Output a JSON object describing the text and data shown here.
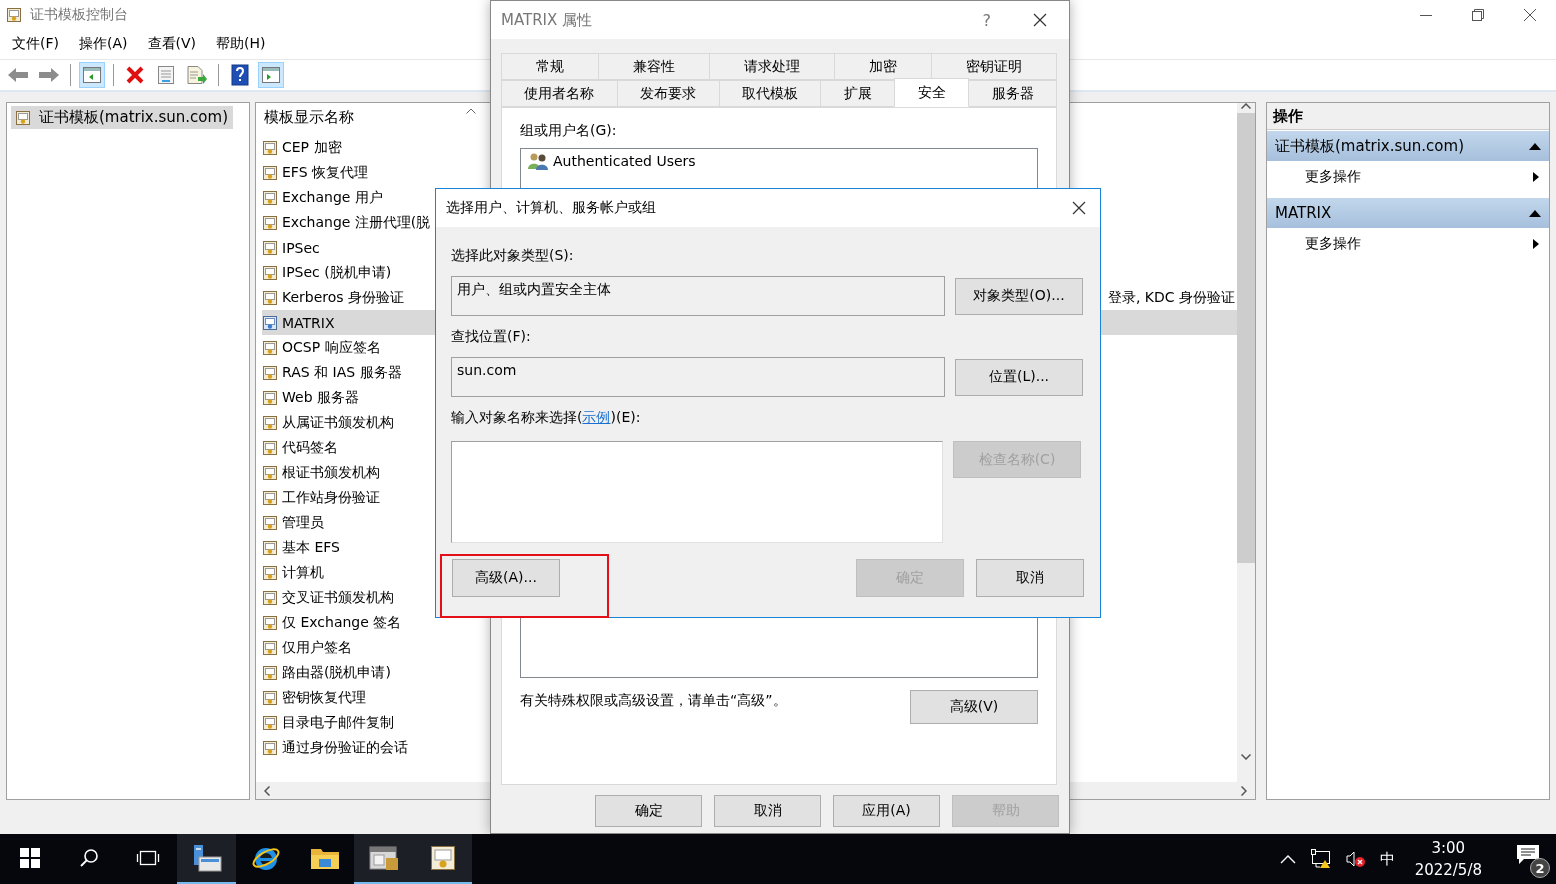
{
  "window": {
    "title": "证书模板控制台"
  },
  "menu": [
    "文件(F)",
    "操作(A)",
    "查看(V)",
    "帮助(H)"
  ],
  "toolbar": [
    {
      "kind": "back",
      "pressed": false
    },
    {
      "kind": "forward",
      "pressed": false
    },
    {
      "kind": "separator"
    },
    {
      "kind": "tree-pane",
      "pressed": true
    },
    {
      "kind": "separator"
    },
    {
      "kind": "delete",
      "pressed": false
    },
    {
      "kind": "properties",
      "pressed": false
    },
    {
      "kind": "export",
      "pressed": false
    },
    {
      "kind": "separator"
    },
    {
      "kind": "help",
      "pressed": false
    },
    {
      "kind": "action-pane",
      "pressed": true
    }
  ],
  "tree": {
    "items": [
      {
        "label": "证书模板(matrix.sun.com)",
        "selected": true
      }
    ]
  },
  "list": {
    "columns": [
      "模板显示名称"
    ],
    "rows": [
      {
        "name": "CEP 加密",
        "selected": false
      },
      {
        "name": "EFS 恢复代理",
        "selected": false
      },
      {
        "name": "Exchange 用户",
        "selected": false
      },
      {
        "name": "Exchange 注册代理(脱",
        "selected": false
      },
      {
        "name": "IPSec",
        "selected": false
      },
      {
        "name": "IPSec (脱机申请)",
        "selected": false
      },
      {
        "name": "Kerberos 身份验证",
        "column_2": "登录, KDC 身份验证",
        "selected": false
      },
      {
        "name": "MATRIX",
        "selected": true
      },
      {
        "name": "OCSP 响应签名",
        "selected": false
      },
      {
        "name": "RAS 和 IAS 服务器",
        "selected": false
      },
      {
        "name": "Web 服务器",
        "selected": false
      },
      {
        "name": "从属证书颁发机构",
        "selected": false
      },
      {
        "name": "代码签名",
        "selected": false
      },
      {
        "name": "根证书颁发机构",
        "selected": false
      },
      {
        "name": "工作站身份验证",
        "selected": false
      },
      {
        "name": "管理员",
        "selected": false
      },
      {
        "name": "基本 EFS",
        "selected": false
      },
      {
        "name": "计算机",
        "selected": false
      },
      {
        "name": "交叉证书颁发机构",
        "selected": false
      },
      {
        "name": "仅 Exchange 签名",
        "selected": false
      },
      {
        "name": "仅用户签名",
        "selected": false
      },
      {
        "name": "路由器(脱机申请)",
        "selected": false
      },
      {
        "name": "密钥恢复代理",
        "selected": false
      },
      {
        "name": "目录电子邮件复制",
        "selected": false
      },
      {
        "name": "通过身份验证的会话",
        "selected": false
      }
    ]
  },
  "actions": {
    "title": "操作",
    "sections": [
      {
        "title": "证书模板(matrix.sun.com)",
        "expanded": true,
        "items": [
          "更多操作"
        ]
      },
      {
        "title": "MATRIX",
        "expanded": true,
        "items": [
          "更多操作"
        ]
      }
    ]
  },
  "properties_dialog": {
    "title": "MATRIX 属性",
    "help": "?",
    "tab_rows": [
      [
        {
          "label": "常规",
          "selected": false
        },
        {
          "label": "兼容性",
          "selected": false
        },
        {
          "label": "请求处理",
          "selected": false
        },
        {
          "label": "加密",
          "selected": false
        },
        {
          "label": "密钥证明",
          "selected": false
        }
      ],
      [
        {
          "label": "使用者名称",
          "selected": false
        },
        {
          "label": "发布要求",
          "selected": false
        },
        {
          "label": "取代模板",
          "selected": false
        },
        {
          "label": "扩展",
          "selected": false
        },
        {
          "label": "安全",
          "selected": true
        },
        {
          "label": "服务器",
          "selected": false
        }
      ]
    ],
    "group_label": "组或用户名(G):",
    "principals": [
      "Authenticated Users"
    ],
    "note": "有关特殊权限或高级设置，请单击“高级”。",
    "advanced_button": "高级(V)",
    "buttons": [
      {
        "label": "确定",
        "disabled": false
      },
      {
        "label": "取消",
        "disabled": false
      },
      {
        "label": "应用(A)",
        "disabled": false
      },
      {
        "label": "帮助",
        "disabled": true
      }
    ]
  },
  "select_dialog": {
    "title": "选择用户、计算机、服务帐户或组",
    "object_type_label": "选择此对象类型(S):",
    "object_type": "用户、组或内置安全主体",
    "object_type_button": "对象类型(O)...",
    "location_label": "查找位置(F):",
    "location": "sun.com",
    "location_button": "位置(L)...",
    "names_label": {
      "before": "输入对象名称来选择(",
      "link": "示例",
      "after": ")(E):"
    },
    "check_button": {
      "label": "检查名称(C)",
      "disabled": true
    },
    "advanced_button": {
      "label": "高级(A)...",
      "highlighted": true
    },
    "buttons": [
      {
        "label": "确定",
        "disabled": true
      },
      {
        "label": "取消",
        "disabled": false
      }
    ]
  },
  "taskbar": {
    "apps": [
      {
        "kind": "start",
        "active": false
      },
      {
        "kind": "search",
        "active": false
      },
      {
        "kind": "task-view",
        "active": false
      },
      {
        "kind": "server-manager",
        "active": true
      },
      {
        "kind": "browser",
        "active": false
      },
      {
        "kind": "folder",
        "active": false
      },
      {
        "kind": "tool",
        "active": true
      },
      {
        "kind": "console",
        "active": true
      }
    ],
    "ime": "中",
    "time": "3:00",
    "date": "2022/5/8",
    "notifications": "2"
  }
}
